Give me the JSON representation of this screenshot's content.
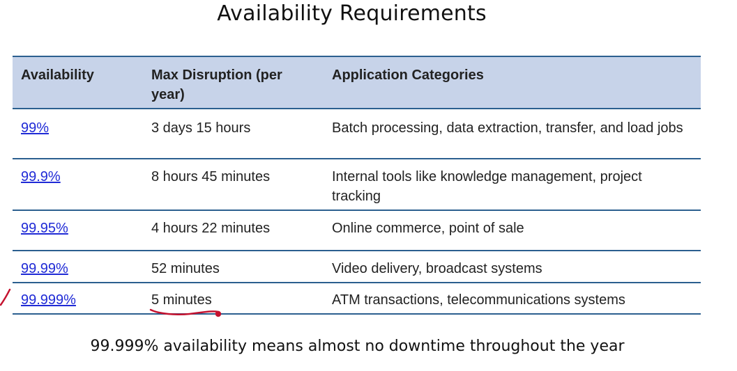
{
  "slide": {
    "title": "Availability Requirements",
    "caption": "99.999% availability means almost no downtime throughout the year"
  },
  "table": {
    "headers": {
      "availability": "Availability",
      "max_disruption": "Max Disruption (per year)",
      "categories": "Application Categories"
    },
    "rows": [
      {
        "availability": "99%",
        "max_disruption": "3 days 15 hours",
        "categories": "Batch processing, data extraction, transfer, and load jobs"
      },
      {
        "availability": "99.9%",
        "max_disruption": "8 hours 45 minutes",
        "categories": "Internal tools like knowledge management, project tracking"
      },
      {
        "availability": "99.95%",
        "max_disruption": "4 hours 22 minutes",
        "categories": "Online commerce, point of sale"
      },
      {
        "availability": "99.99%",
        "max_disruption": "52 minutes",
        "categories": "Video delivery, broadcast systems"
      },
      {
        "availability": "99.999%",
        "max_disruption": "5 minutes",
        "categories": "ATM transactions, telecommunications systems"
      }
    ]
  },
  "colors": {
    "header_background": "#c7d3e9",
    "rule_line": "#2b5f8f",
    "link": "#1f2ad6",
    "annotation_ink": "#c4122f"
  }
}
